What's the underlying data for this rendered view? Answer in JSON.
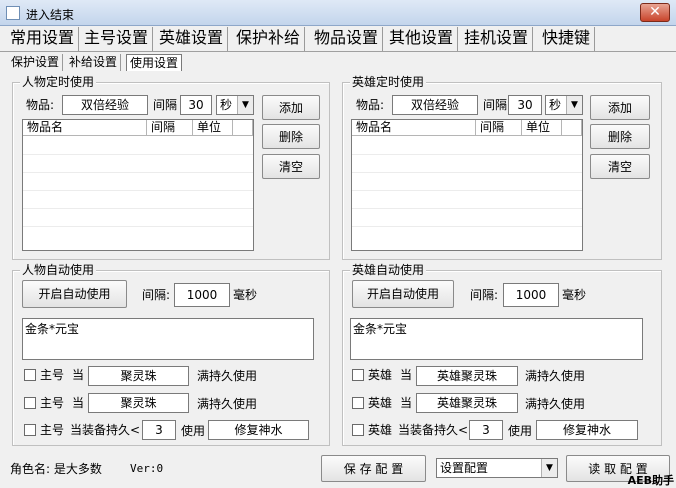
{
  "window": {
    "title": "进入结束",
    "close_glyph": "✕"
  },
  "main_tabs": [
    "常用设置",
    "主号设置",
    "英雄设置",
    "保护补给",
    "物品设置",
    "其他设置",
    "挂机设置",
    "快捷键"
  ],
  "active_main_tab": "保护补给",
  "sub_tabs": [
    "保护设置",
    "补给设置",
    "使用设置"
  ],
  "active_sub_tab": "使用设置",
  "char_timed": {
    "group_label": "人物定时使用",
    "item_label": "物品:",
    "item_value": "双倍经验",
    "interval_label": "间隔",
    "interval_value": "30",
    "unit_value": "秒",
    "columns": [
      "物品名",
      "间隔",
      "单位"
    ],
    "add": "添加",
    "delete": "删除",
    "clear": "清空"
  },
  "hero_timed": {
    "group_label": "英雄定时使用",
    "item_label": "物品:",
    "item_value": "双倍经验",
    "interval_label": "间隔",
    "interval_value": "30",
    "unit_value": "秒",
    "columns": [
      "物品名",
      "间隔",
      "单位"
    ],
    "add": "添加",
    "delete": "删除",
    "clear": "清空"
  },
  "char_auto": {
    "group_label": "人物自动使用",
    "start_button": "开启自动使用",
    "interval_label": "间隔:",
    "interval_value": "1000",
    "unit": "毫秒",
    "items_text": "金条*元宝",
    "rows": [
      {
        "who": "主号",
        "when": "当",
        "item": "聚灵珠",
        "suffix": "满持久使用"
      },
      {
        "who": "主号",
        "when": "当",
        "item": "聚灵珠",
        "suffix": "满持久使用"
      },
      {
        "who": "主号",
        "when": "当装备持久<",
        "value": "3",
        "use": "使用",
        "item": "修复神水"
      }
    ]
  },
  "hero_auto": {
    "group_label": "英雄自动使用",
    "start_button": "开启自动使用",
    "interval_label": "间隔:",
    "interval_value": "1000",
    "unit": "毫秒",
    "items_text": "金条*元宝",
    "rows": [
      {
        "who": "英雄",
        "when": "当",
        "item": "英雄聚灵珠",
        "suffix": "满持久使用"
      },
      {
        "who": "英雄",
        "when": "当",
        "item": "英雄聚灵珠",
        "suffix": "满持久使用"
      },
      {
        "who": "英雄",
        "when": "当装备持久<",
        "value": "3",
        "use": "使用",
        "item": "修复神水"
      }
    ]
  },
  "footer": {
    "role_label": "角色名: 是大多数",
    "version": "Ver:0",
    "save_button": "保 存 配 置",
    "config_select": "设置配置",
    "load_button": "读 取 配 置",
    "watermark": "AEB助手"
  }
}
